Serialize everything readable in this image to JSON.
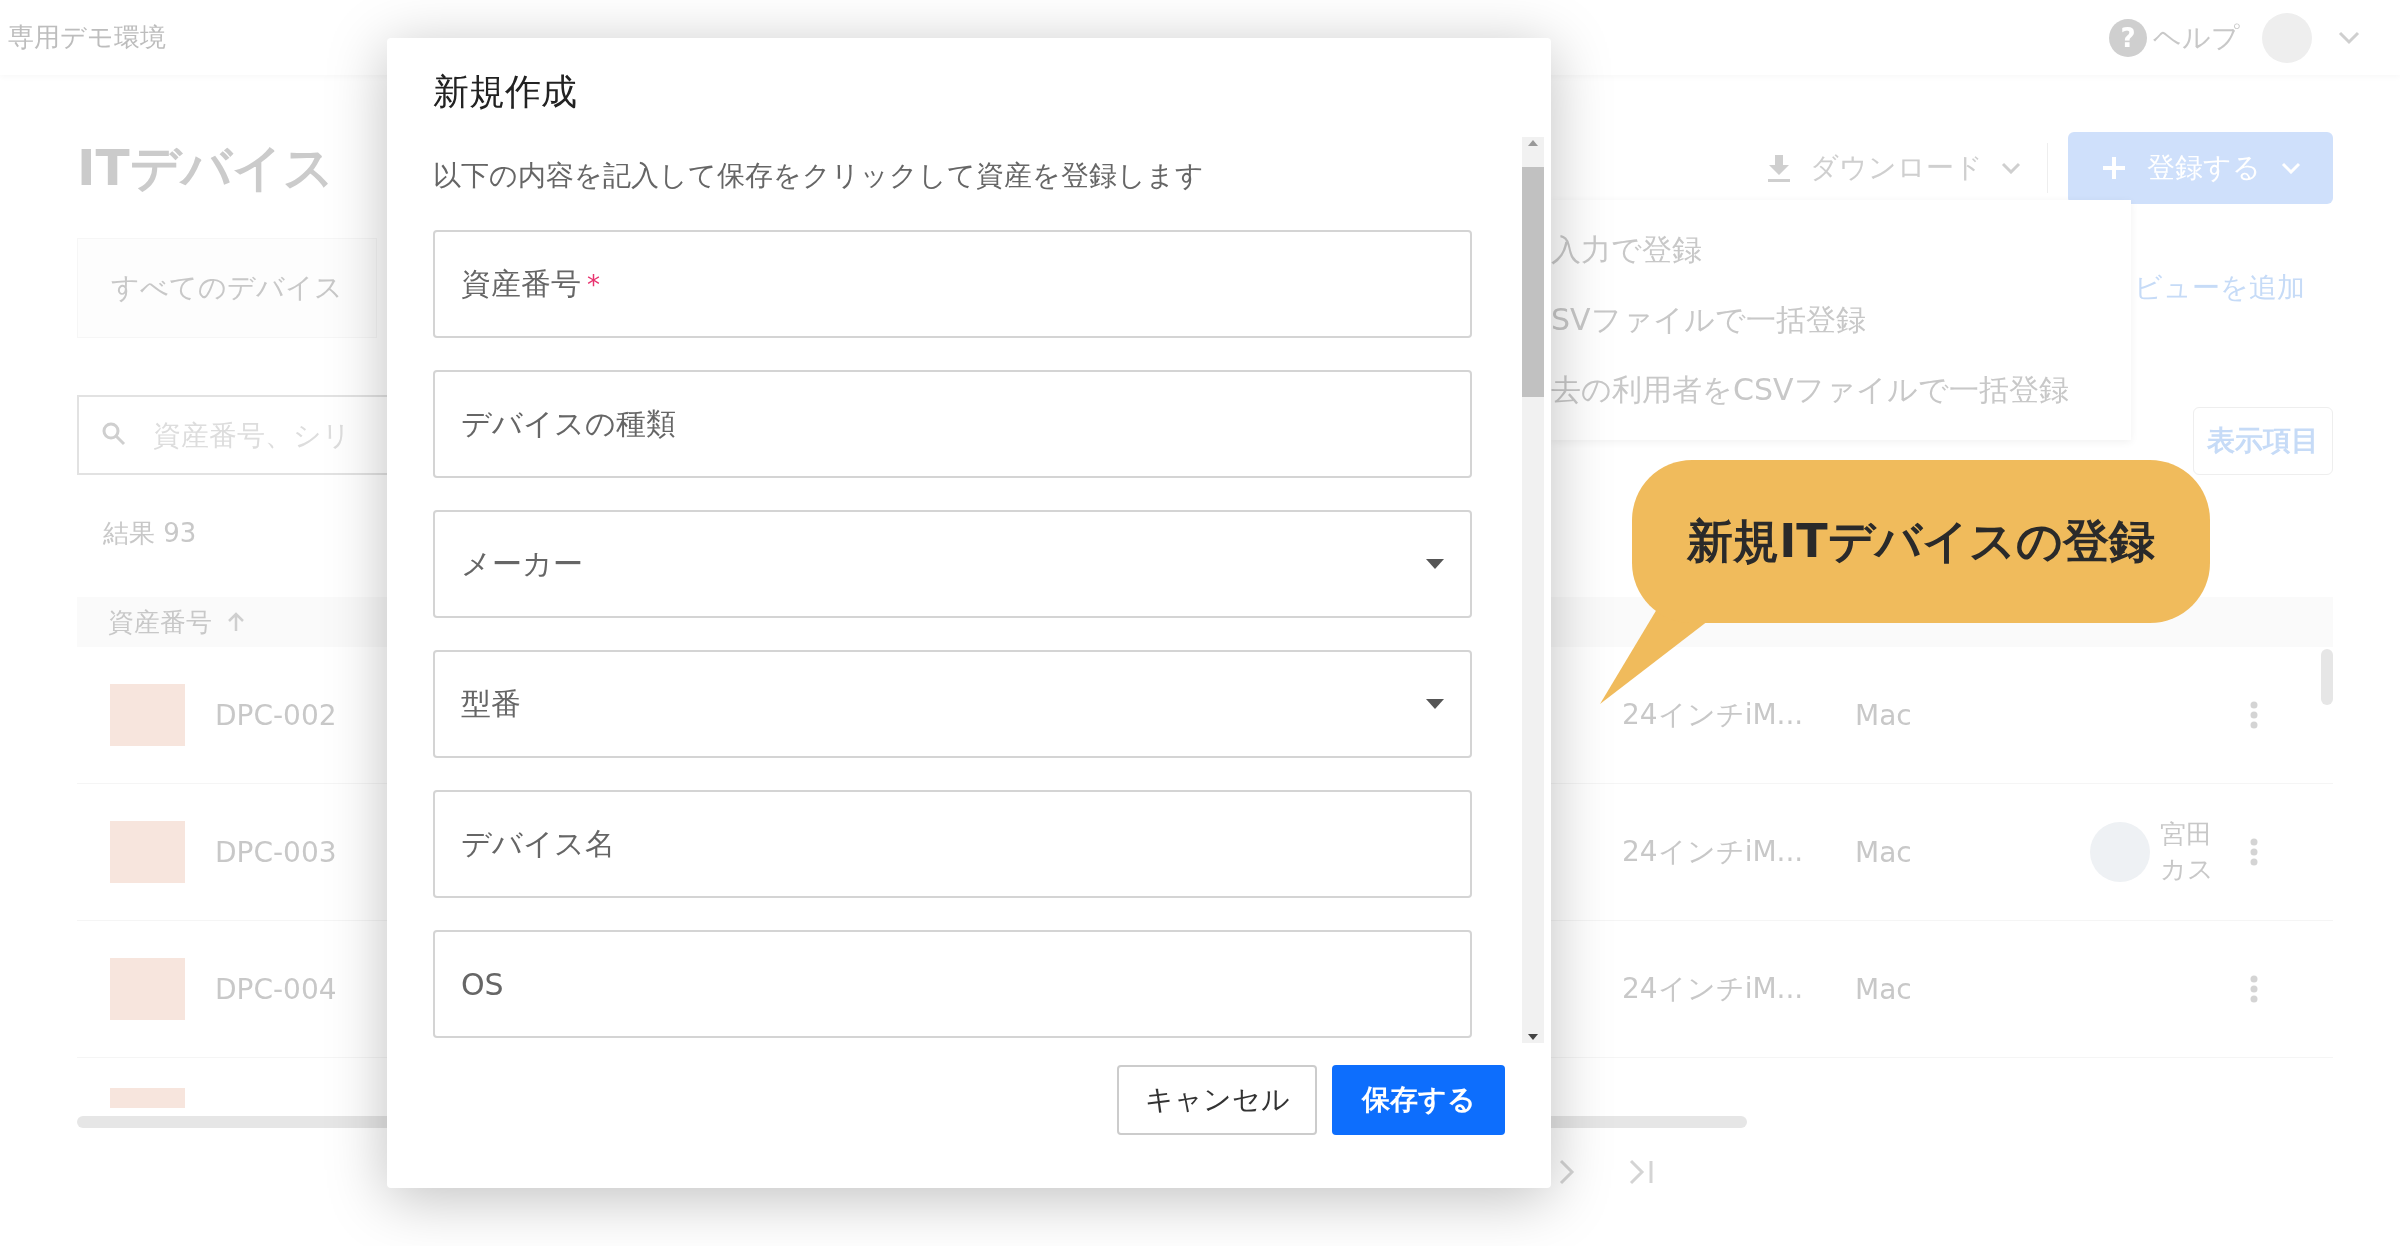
{
  "app_header": {
    "workspace": "専用デモ環境",
    "help_icon": "?",
    "help": "ヘルプ"
  },
  "page": {
    "title": "ITデバイス",
    "download": "ダウンロード",
    "register": "登録する",
    "view": "すべてのデバイス",
    "add_view": "ビューを追加",
    "search": {
      "placeholder": "資産番号、シリ"
    },
    "display_items": "表示項目",
    "result_count": "結果 93",
    "sort_column": "資産番号"
  },
  "register_menu": [
    "入力で登録",
    "SVファイルで一括登録",
    "去の利用者をCSVファイルで一括登録"
  ],
  "rows": [
    {
      "asset": "DPC-002",
      "model": "24インチiM...",
      "os": "Mac"
    },
    {
      "asset": "DPC-003",
      "model": "24インチiM...",
      "os": "Mac",
      "user": {
        "name": "宮田",
        "sub": "カス"
      }
    },
    {
      "asset": "DPC-004",
      "model": "24インチiM...",
      "os": "Mac"
    }
  ],
  "dialog": {
    "title": "新規作成",
    "description": "以下の内容を記入して保存をクリックして資産を登録します",
    "fields": [
      {
        "kind": "text",
        "placeholder": "資産番号",
        "required": true
      },
      {
        "kind": "text",
        "placeholder": "デバイスの種類",
        "required": false
      },
      {
        "kind": "select",
        "placeholder": "メーカー",
        "required": false
      },
      {
        "kind": "select",
        "placeholder": "型番",
        "required": false
      },
      {
        "kind": "text",
        "placeholder": "デバイス名",
        "required": false
      },
      {
        "kind": "text",
        "placeholder": "OS",
        "required": false
      }
    ],
    "required_mark": "*",
    "cancel": "キャンセル",
    "save": "保存する"
  },
  "callout": {
    "text": "新規ITデバイスの登録"
  }
}
